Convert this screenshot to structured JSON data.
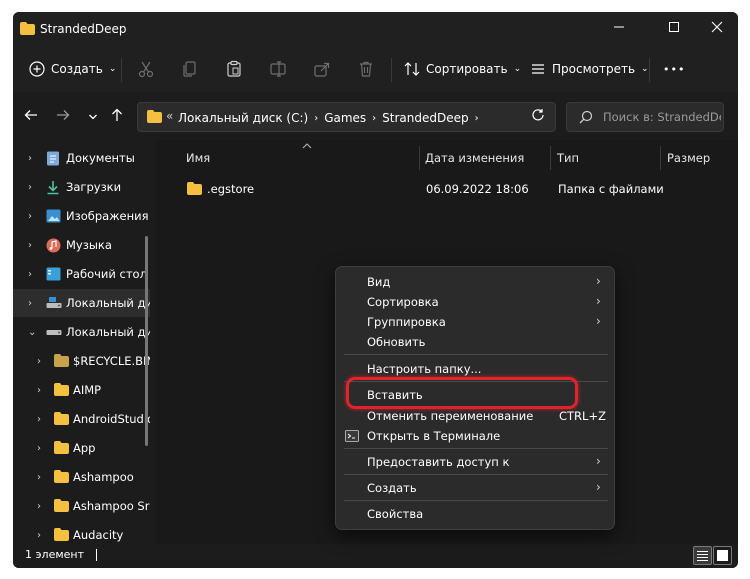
{
  "window": {
    "title": "StrandedDeep"
  },
  "toolbar": {
    "create_label": "Создать",
    "sort_label": "Сортировать",
    "view_label": "Просмотреть",
    "more_label": "•••"
  },
  "address": {
    "prefix": "«",
    "crumbs": [
      "Локальный диск (C:)",
      "Games",
      "StrandedDeep"
    ]
  },
  "search": {
    "placeholder": "Поиск в: StrandedDeep"
  },
  "sidebar": {
    "items": [
      {
        "label": "Документы",
        "icon": "documents-icon"
      },
      {
        "label": "Загрузки",
        "icon": "downloads-icon"
      },
      {
        "label": "Изображения",
        "icon": "pictures-icon"
      },
      {
        "label": "Музыка",
        "icon": "music-icon"
      },
      {
        "label": "Рабочий стол",
        "icon": "desktop-icon"
      },
      {
        "label": "Локальный ди",
        "icon": "drive-icon"
      },
      {
        "label": "Локальный ди",
        "icon": "drive-icon"
      },
      {
        "label": "$RECYCLE.BIN",
        "icon": "folder-icon"
      },
      {
        "label": "AIMP",
        "icon": "folder-icon"
      },
      {
        "label": "AndroidStudio",
        "icon": "folder-icon"
      },
      {
        "label": "App",
        "icon": "folder-icon"
      },
      {
        "label": "Ashampoo",
        "icon": "folder-icon"
      },
      {
        "label": "Ashampoo Sr",
        "icon": "folder-icon"
      },
      {
        "label": "Audacity",
        "icon": "folder-icon"
      }
    ]
  },
  "columns": {
    "name": "Имя",
    "date": "Дата изменения",
    "type": "Тип",
    "size": "Размер"
  },
  "files": [
    {
      "name": ".egstore",
      "date": "06.09.2022 18:06",
      "type": "Папка с файлами",
      "size": ""
    }
  ],
  "context_menu": {
    "view": "Вид",
    "sort": "Сортировка",
    "group": "Группировка",
    "refresh": "Обновить",
    "customize": "Настроить папку...",
    "paste": "Вставить",
    "undo_rename": "Отменить переименование",
    "undo_shortcut": "CTRL+Z",
    "open_terminal": "Открыть в Терминале",
    "share": "Предоставить доступ к",
    "create": "Создать",
    "properties": "Свойства"
  },
  "status": {
    "count": "1 элемент"
  },
  "colors": {
    "highlight": "#e1242c",
    "folder": "#f4c040",
    "background": "#1c1c1c"
  }
}
